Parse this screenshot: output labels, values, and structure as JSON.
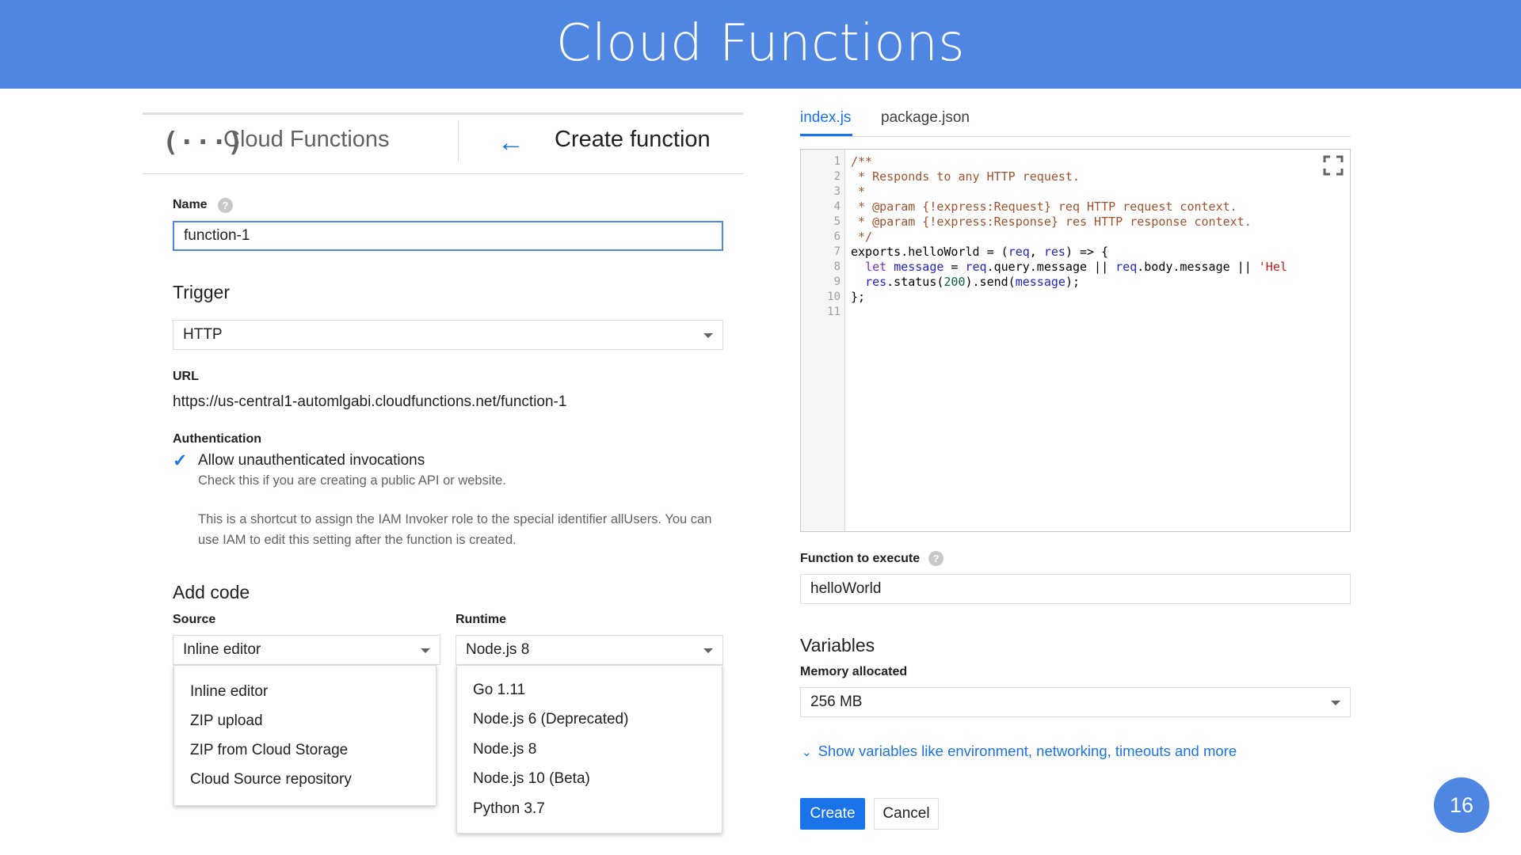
{
  "slide": {
    "title": "Cloud Functions",
    "page_number": "16",
    "accent_color": "#4f86e2"
  },
  "header": {
    "brand_icon": "(···)",
    "brand_label": "Cloud Functions",
    "back_icon": "arrow-left-icon",
    "page_title": "Create function"
  },
  "form": {
    "name_label": "Name",
    "name_value": "function-1",
    "trigger_heading": "Trigger",
    "trigger_value": "HTTP",
    "url_label": "URL",
    "url_value": "https://us-central1-automlgabi.cloudfunctions.net/function-1",
    "auth_label": "Authentication",
    "auth_option": "Allow unauthenticated invocations",
    "auth_checked": true,
    "auth_hint": "Check this if you are creating a public API or website.",
    "auth_note": "This is a shortcut to assign the IAM Invoker role to the special identifier allUsers. You can use IAM to edit this setting after the function is created.",
    "add_code_heading": "Add code",
    "source_label": "Source",
    "source_value": "Inline editor",
    "source_options": [
      "Inline editor",
      "ZIP upload",
      "ZIP from Cloud Storage",
      "Cloud Source repository"
    ],
    "runtime_label": "Runtime",
    "runtime_value": "Node.js 8",
    "runtime_options": [
      "Go 1.11",
      "Node.js 6 (Deprecated)",
      "Node.js 8",
      "Node.js 10 (Beta)",
      "Python 3.7"
    ]
  },
  "editor": {
    "tabs": [
      "index.js",
      "package.json"
    ],
    "active_tab": "index.js",
    "line_numbers": [
      "1",
      "2",
      "3",
      "4",
      "5",
      "6",
      "7",
      "8",
      "9",
      "10",
      "11"
    ],
    "code": {
      "l1": "/**",
      "l2": " * Responds to any HTTP request.",
      "l3": " *",
      "l4": " * @param {!express:Request} req HTTP request context.",
      "l5": " * @param {!express:Response} res HTTP response context.",
      "l6": " */",
      "l7": {
        "a": "exports.helloWorld = (",
        "b": "req",
        "c": ", ",
        "d": "res",
        "e": ") => {"
      },
      "l8": {
        "a": "  ",
        "b": "let",
        "c": " ",
        "d": "message",
        "e": " = ",
        "f": "req",
        "g": ".query.message || ",
        "h": "req",
        "i": ".body.message || ",
        "j": "'Hel"
      },
      "l9": {
        "a": "  ",
        "b": "res",
        "c": ".status(",
        "d": "200",
        "e": ").send(",
        "f": "message",
        "g": ");"
      },
      "l10": "};",
      "l11": ""
    }
  },
  "function_settings": {
    "entry_label": "Function to execute",
    "entry_value": "helloWorld",
    "variables_heading": "Variables",
    "memory_label": "Memory allocated",
    "memory_value": "256 MB",
    "more_link": "Show variables like environment, networking, timeouts and more"
  },
  "actions": {
    "create": "Create",
    "cancel": "Cancel"
  },
  "icons": {
    "help": "help-icon",
    "dropdown": "caret-down-icon",
    "fullscreen": "fullscreen-icon",
    "checkbox": "checkbox-checked-icon",
    "expand": "chevron-down-icon"
  }
}
